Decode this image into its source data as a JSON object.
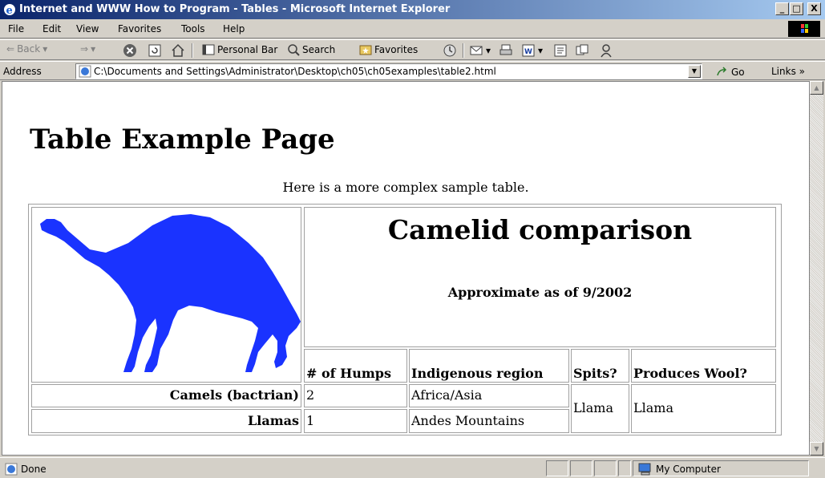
{
  "window": {
    "title": "Internet and WWW How to Program - Tables - Microsoft Internet Explorer",
    "minimize": "_",
    "maximize": "□",
    "close": "X"
  },
  "menu": [
    "File",
    "Edit",
    "View",
    "Favorites",
    "Tools",
    "Help"
  ],
  "toolbar": {
    "back": "Back",
    "personal_bar": "Personal Bar",
    "search": "Search",
    "favorites": "Favorites"
  },
  "address": {
    "label": "Address",
    "value": "C:\\Documents and Settings\\Administrator\\Desktop\\ch05\\ch05examples\\table2.html",
    "go": "Go",
    "links": "Links »"
  },
  "page": {
    "heading": "Table Example Page",
    "caption": "Here is a more complex sample table.",
    "table": {
      "title": "Camelid comparison",
      "subtitle": "Approximate as of 9/2002",
      "headers": [
        "# of Humps",
        "Indigenous region",
        "Spits?",
        "Produces Wool?"
      ],
      "rows": [
        {
          "name": "Camels (bactrian)",
          "humps": "2",
          "region": "Africa/Asia"
        },
        {
          "name": "Llamas",
          "humps": "1",
          "region": "Andes Mountains"
        }
      ],
      "spits": "Llama",
      "wool": "Llama"
    }
  },
  "status": {
    "text": "Done",
    "zone": "My Computer"
  },
  "colors": {
    "camel": "#1a33ff",
    "titlebar_start": "#0a246a"
  }
}
